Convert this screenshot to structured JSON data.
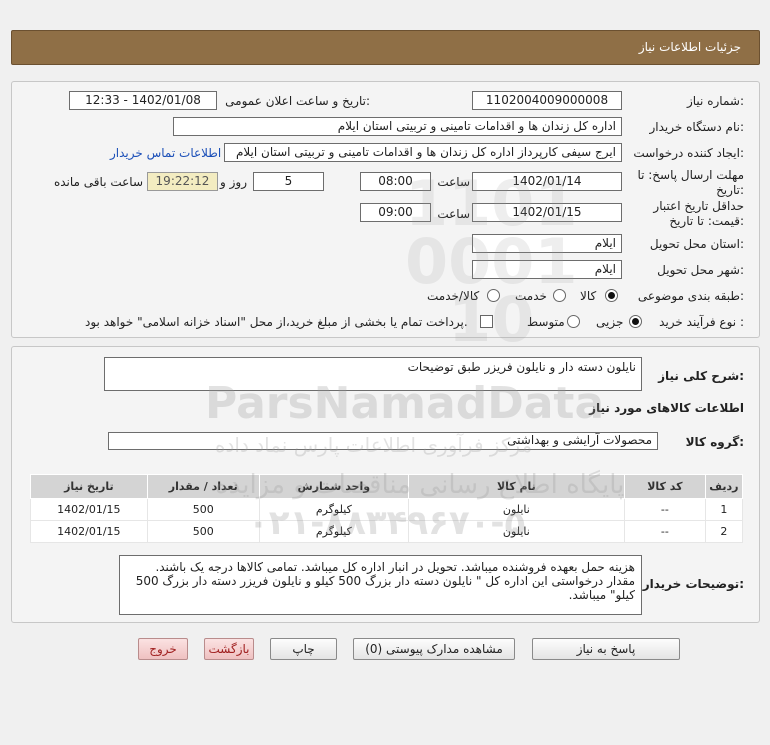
{
  "header": {
    "title": "جزئیات اطلاعات نیاز"
  },
  "form": {
    "need_number_label": "شماره نیاز:",
    "need_number": "1102004009000008",
    "announce_label": "تاریخ و ساعت اعلان عمومی:",
    "announce_value": "1402/01/08 - 12:33",
    "buyer_org_label": "نام دستگاه خریدار:",
    "buyer_org": "اداره کل زندان ها و اقدامات تامینی و تربیتی استان ایلام",
    "requester_label": "ایجاد کننده درخواست:",
    "requester": "ایرج  سیفی کارپرداز اداره کل زندان ها و اقدامات تامینی و تربیتی استان ایلام",
    "contact_link": "اطلاعات تماس خریدار",
    "deadline_label_1": "مهلت ارسال پاسخ: تا",
    "deadline_label_2": "تاریخ:",
    "deadline_date": "1402/01/14",
    "time_label": "ساعت",
    "deadline_time": "08:00",
    "days_value": "5",
    "days_label": "روز و",
    "remaining_time": "19:22:12",
    "remaining_label": "ساعت باقی مانده",
    "validity_label_1": "حداقل تاریخ اعتبار",
    "validity_label_2": "قیمت: تا تاریخ:",
    "validity_date": "1402/01/15",
    "validity_time_label": "ساعت",
    "validity_time": "09:00",
    "province_label": "استان محل تحویل:",
    "province": "ایلام",
    "city_label": "شهر محل تحویل:",
    "city": "ایلام",
    "category_label": "طبقه بندی موضوعی:",
    "category_options": [
      "کالا",
      "خدمت",
      "کالا/خدمت"
    ],
    "category_selected": "کالا",
    "process_label": "نوع فرآیند خرید :",
    "process_options": [
      "جزیی",
      "متوسط"
    ],
    "process_selected": "جزیی",
    "payment_note": "پرداخت تمام یا بخشی از مبلغ خرید،از محل \"اسناد خزانه اسلامی\" خواهد بود."
  },
  "description": {
    "label": "شرح کلی نیاز:",
    "text": "نایلون دسته دار و نایلون فریزر طبق توضیحات"
  },
  "goods": {
    "section_title": "اطلاعات کالاهای مورد نیاز",
    "group_label": "گروه کالا:",
    "group_value": "محصولات آرایشی و بهداشتی",
    "columns": [
      "ردیف",
      "کد کالا",
      "نام کالا",
      "واحد شمارش",
      "تعداد / مقدار",
      "تاریخ نیاز"
    ],
    "rows": [
      [
        "1",
        "--",
        "نایلون",
        "کیلوگرم",
        "500",
        "1402/01/15"
      ],
      [
        "2",
        "--",
        "نایلون",
        "کیلوگرم",
        "500",
        "1402/01/15"
      ]
    ]
  },
  "buyer_notes": {
    "label": "توضیحات خریدار:",
    "text": "هزینه حمل بعهده فروشنده میباشد. تحویل در انبار اداره کل میباشد. تمامی کالاها درجه یک باشند. مقدار درخواستی این اداره کل \" نایلون دسته دار بزرگ 500 کیلو و نایلون فریزر دسته دار بزرگ 500 کیلو\" میباشد."
  },
  "buttons": {
    "reply": "پاسخ به نیاز",
    "attachments": "مشاهده مدارک پیوستی (0)",
    "print": "چاپ",
    "back": "بازگشت",
    "exit": "خروج"
  },
  "watermark": {
    "big": "ParsNamadData",
    "fa_1": "مرکز فرآوری اطلاعات پارس نماد داده",
    "fa_2": "پایگاه اطلاع رسانی مناقصات و مزایده",
    "phone": "۰۲۱-۸۸۳۴۹۶۷۰-۵"
  },
  "colors": {
    "header": "#8f6f46",
    "link": "#1b4fb8",
    "remaining_bg": "#f3ecc1",
    "table_header": "#d4d4d4"
  }
}
